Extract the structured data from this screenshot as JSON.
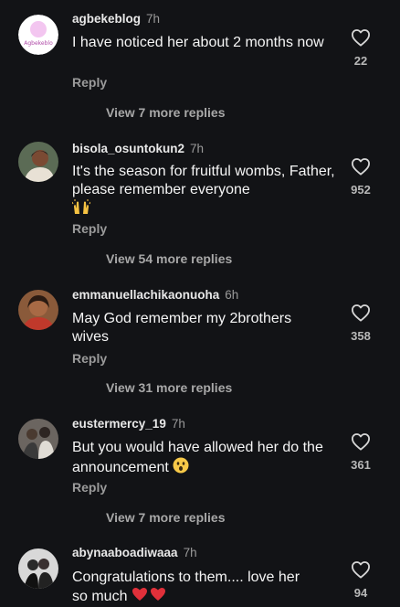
{
  "comments": [
    {
      "username": "agbekeblog",
      "time": "7h",
      "text": "I have noticed her about 2 months now",
      "likes": "22",
      "reply_label": "Reply",
      "view_more": "View 7 more replies",
      "avatar_text": "Agbekeblo"
    },
    {
      "username": "bisola_osuntokun2",
      "time": "7h",
      "text": "It's the season for fruitful wombs, Father, please remember everyone",
      "emoji": "raising-hands",
      "likes": "952",
      "reply_label": "Reply",
      "view_more": "View 54 more replies"
    },
    {
      "username": "emmanuellachikaonuoha",
      "time": "6h",
      "text": "May God remember my 2brothers wives",
      "likes": "358",
      "reply_label": "Reply",
      "view_more": "View 31 more replies"
    },
    {
      "username": "eustermercy_19",
      "time": "7h",
      "text": "But you would have allowed her do the announcement",
      "emoji": "astonished-face",
      "likes": "361",
      "reply_label": "Reply",
      "view_more": "View 7 more replies"
    },
    {
      "username": "abynaaboadiwaaa",
      "time": "7h",
      "text_line1": "Congratulations to them.... love her",
      "text_line2": "so much",
      "emoji": "red-hearts",
      "likes": "94"
    }
  ],
  "colors": {
    "background": "#121316",
    "text": "#f5f5f5",
    "muted": "#9b9b9b"
  },
  "icons": [
    "heart-outline-icon"
  ]
}
